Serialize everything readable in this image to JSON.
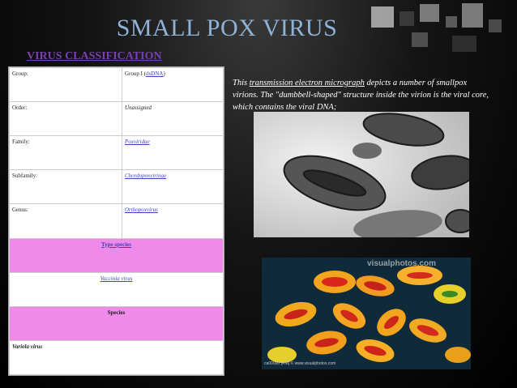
{
  "slide": {
    "title": "SMALL POX VIRUS",
    "subtitle": "VIRUS CLASSIFICATION"
  },
  "classification": {
    "rows": [
      {
        "label": "Group:",
        "value_prefix": "Group I (",
        "value_link": "dsDNA",
        "value_suffix": ")"
      },
      {
        "label": "Order:",
        "value": "Unassigned"
      },
      {
        "label": "Family:",
        "value_link": "Poxviridae"
      },
      {
        "label": "Subfamily:",
        "value_link": "Chordopoxvirinae"
      },
      {
        "label": "Genus:",
        "value_link": "Orthopoxvirus"
      }
    ],
    "type_species_header": "Type species",
    "type_species_value": "Vaccinia virus",
    "species_header": "Species",
    "species_value": "Variola virus"
  },
  "caption": {
    "part1": "This ",
    "link": "transmission electron micrograph",
    "part2": " depicts a number of smallpox virions. The \"dumbbell-shaped\" structure inside the virion is the viral core, which contains the viral DNA;"
  },
  "image2": {
    "watermark": "visualphotos.com",
    "credit": "ca00000 [RM] © www.visualphotos.com"
  },
  "colors": {
    "title": "#8fb2d8",
    "subtitle": "#7b3fb2",
    "pink_row": "#f08ae8",
    "link": "#3b43c4"
  }
}
